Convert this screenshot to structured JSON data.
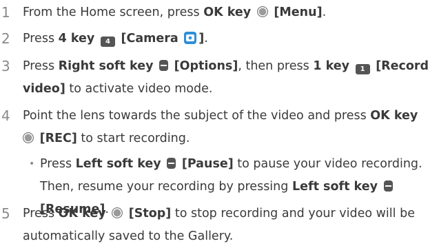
{
  "steps": [
    {
      "number": "1",
      "t1": "From the Home screen, press ",
      "b1": "OK key",
      "b2": "[Menu]",
      "t2": "."
    },
    {
      "number": "2",
      "t1": "Press ",
      "b1": "4 key",
      "key_label": "4",
      "b2": "[Camera",
      "b3": "]",
      "t2": "."
    },
    {
      "number": "3",
      "t1": "Press ",
      "b1": "Right soft key",
      "b2": "[Options]",
      "t2": ", then press ",
      "b3": "1 key",
      "key_label": "1",
      "b4": "[Record",
      "b5": "video]",
      "t3": " to activate video mode."
    },
    {
      "number": "4",
      "t1": "Point the lens towards the subject of the video and press ",
      "b1": "OK key",
      "b2": "[REC]",
      "t2": " to start recording.",
      "sub": {
        "bullet": "•",
        "t1": "Press ",
        "b1": "Left soft key",
        "b2": "[Pause]",
        "t2": " to pause your video recording.",
        "t3": "Then, resume your recording by pressing ",
        "b3": "Left soft key",
        "b4": "[Resume]",
        "t4": "."
      }
    },
    {
      "number": "5",
      "t1": "Press ",
      "b1": "OK key",
      "b2": "[Stop]",
      "t2": " to stop recording and your video will be",
      "t3": "automatically saved to the Gallery."
    }
  ],
  "icons": {
    "ok_key": "ok-key-icon",
    "soft_key": "soft-key-icon",
    "number_key": "number-key-icon",
    "camera_app": "camera-app-icon"
  },
  "colors": {
    "text": "#3a3a3a",
    "step_number": "#8a8a8a",
    "camera_icon": "#2d8fd8",
    "key_icon": "#555555"
  }
}
